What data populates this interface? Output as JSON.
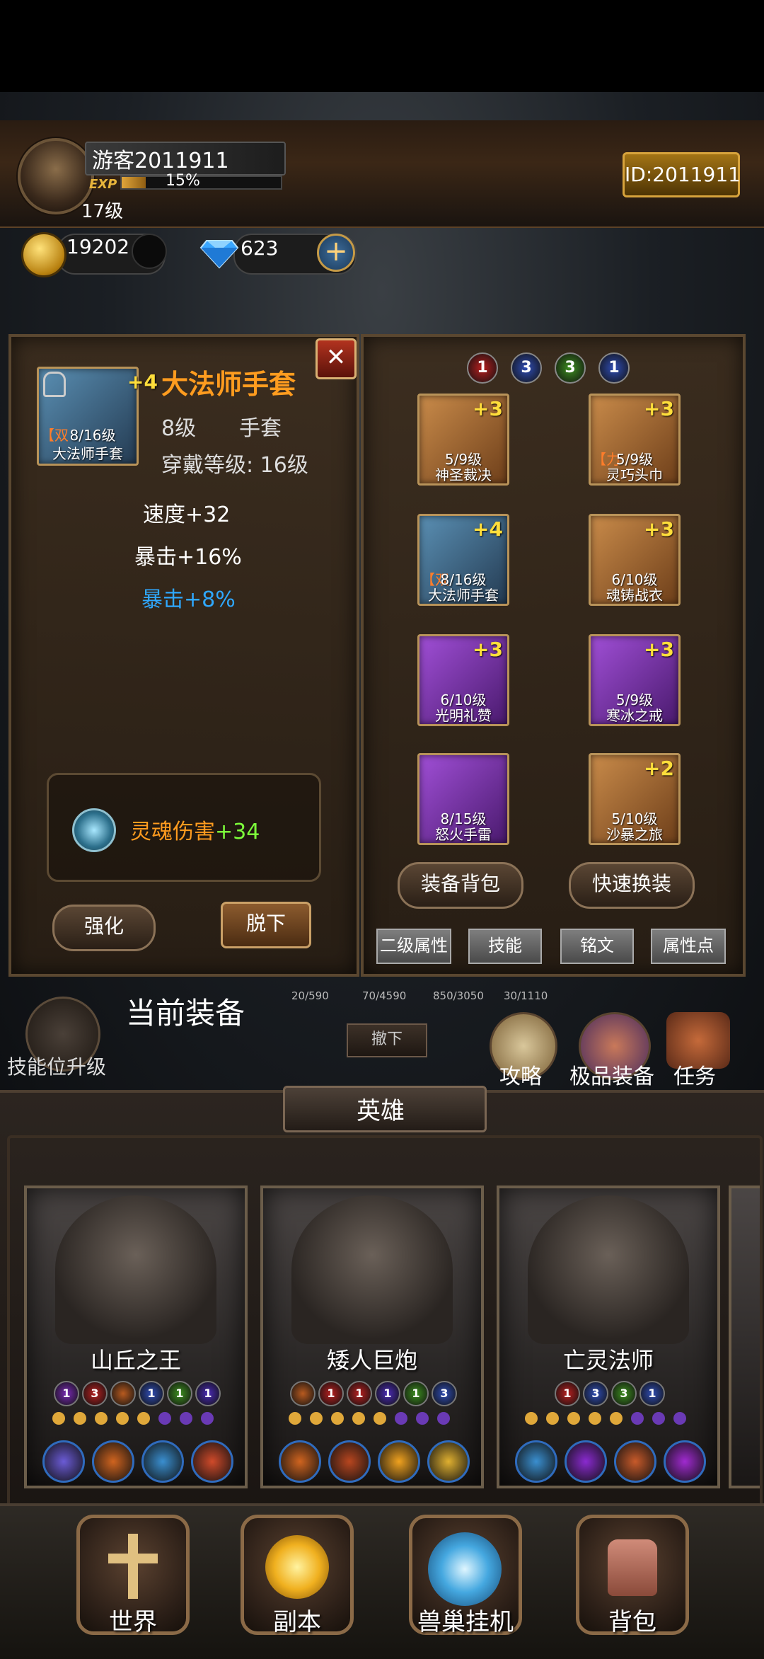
{
  "player": {
    "name": "游客2011911",
    "exp_label": "EXP",
    "exp_percent": "15%",
    "exp_fraction": 0.15,
    "level": "17级",
    "id": "ID:2011911",
    "gold": "19202",
    "diamonds": "623"
  },
  "item_detail": {
    "name": "大法师手套",
    "plus": "+4",
    "icon_tag": "【双",
    "icon_level": "8/16级",
    "icon_name": "大法师手套",
    "item_level": "8级",
    "type": "手套",
    "wear_level": "穿戴等级: 16级",
    "stats": [
      "速度+32",
      "暴击+16%"
    ],
    "bonus_stat": "暴击+8%",
    "soul_label": "灵魂伤害",
    "soul_value": "+34",
    "enhance_btn": "强化",
    "unequip_btn": "脱下",
    "close_glyph": "✕"
  },
  "gem_row": [
    "1",
    "3",
    "3",
    "1"
  ],
  "equipment": [
    {
      "plus": "+3",
      "tag": "",
      "level": "5/9级",
      "name": "神圣裁决",
      "rarity": "brown"
    },
    {
      "plus": "+3",
      "tag": "【力",
      "level": "5/9级",
      "name": "灵巧头巾",
      "rarity": "brown"
    },
    {
      "plus": "+4",
      "tag": "【双",
      "level": "8/16级",
      "name": "大法师手套",
      "rarity": "blue"
    },
    {
      "plus": "+3",
      "tag": "",
      "level": "6/10级",
      "name": "魂铸战衣",
      "rarity": "brown"
    },
    {
      "plus": "+3",
      "tag": "",
      "level": "6/10级",
      "name": "光明礼赞",
      "rarity": "purple"
    },
    {
      "plus": "+3",
      "tag": "",
      "level": "5/9级",
      "name": "寒冰之戒",
      "rarity": "purple"
    },
    {
      "plus": "",
      "tag": "",
      "level": "8/15级",
      "name": "怒火手雷",
      "rarity": "purple"
    },
    {
      "plus": "+2",
      "tag": "",
      "level": "5/10级",
      "name": "沙暴之旅",
      "rarity": "brown"
    }
  ],
  "equip_buttons": {
    "bag": "装备背包",
    "swap": "快速换装"
  },
  "tabs": [
    "二级属性",
    "技能",
    "铭文",
    "属性点"
  ],
  "behind": {
    "counts": [
      "20/590",
      "70/4590",
      "850/3050",
      "30/1110"
    ],
    "current_equip": "当前装备",
    "skill_upgrade": "技能位升级",
    "unequip_small": "撤下",
    "guide": "攻略",
    "top_equip": "极品装备",
    "task": "任务"
  },
  "heroes_title": "英雄",
  "heroes": [
    {
      "name": "山丘之王",
      "gems": [
        "1",
        "3",
        "",
        "1",
        "1",
        "1"
      ],
      "colors": [
        "#7a2ab5",
        "#b81f1f",
        "#b85a1f",
        "#2f4db5",
        "#3d8f1f",
        "#4a2ab5"
      ]
    },
    {
      "name": "矮人巨炮",
      "gems": [
        "",
        "1",
        "1",
        "1",
        "1",
        "3"
      ],
      "colors": [
        "#b85a1f",
        "#b81f1f",
        "#b81f1f",
        "#4a2ab5",
        "#3d8f1f",
        "#2f4db5"
      ]
    },
    {
      "name": "亡灵法师",
      "gems": [
        "1",
        "3",
        "3",
        "1"
      ],
      "colors": [
        "#b81f1f",
        "#2f4db5",
        "#3d8f1f",
        "#2f4db5"
      ]
    }
  ],
  "bottom_nav": [
    "世界",
    "副本",
    "兽巢挂机",
    "背包"
  ]
}
